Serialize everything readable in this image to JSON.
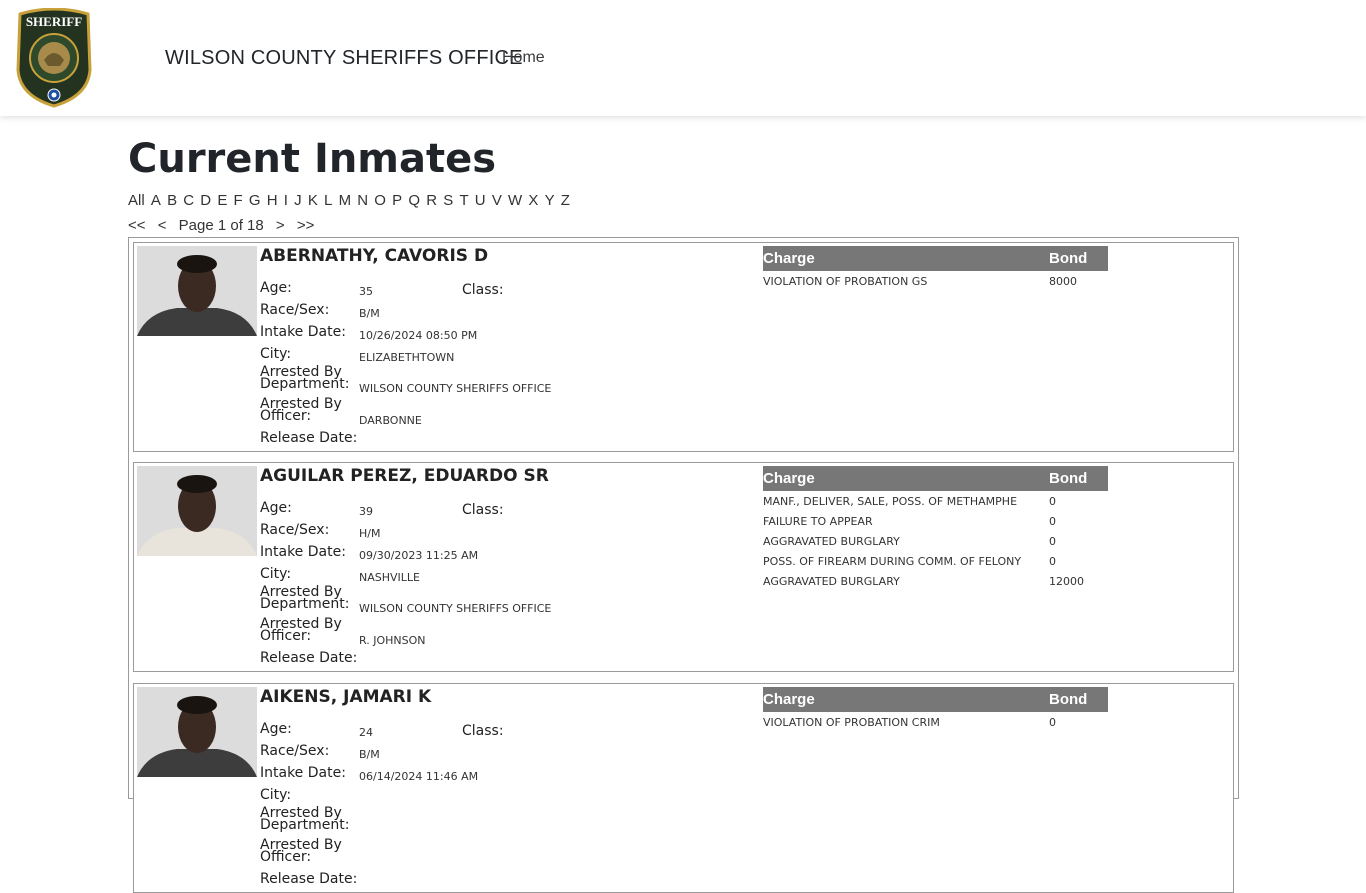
{
  "header": {
    "logo_text": "SHERIFF",
    "brand": "WILSON COUNTY SHERIFFS OFFICE",
    "nav_home": "Home"
  },
  "page_title": "Current Inmates",
  "alphabet": [
    "All",
    "A",
    "B",
    "C",
    "D",
    "E",
    "F",
    "G",
    "H",
    "I",
    "J",
    "K",
    "L",
    "M",
    "N",
    "O",
    "P",
    "Q",
    "R",
    "S",
    "T",
    "U",
    "V",
    "W",
    "X",
    "Y",
    "Z"
  ],
  "pager": {
    "first": "<<",
    "prev": "<",
    "text": "Page 1 of 18",
    "next": ">",
    "last": ">>"
  },
  "labels": {
    "age": "Age:",
    "class": "Class:",
    "race_sex": "Race/Sex:",
    "intake_date": "Intake Date:",
    "city": "City:",
    "arrested_by_department_1": "Arrested By",
    "arrested_by_department_2": "Department:",
    "arrested_by_officer_1": "Arrested By",
    "arrested_by_officer_2": "Officer:",
    "release_date": "Release Date:",
    "charge": "Charge",
    "bond": "Bond"
  },
  "inmates": [
    {
      "name": "ABERNATHY, CAVORIS D",
      "age": "35",
      "race_sex": "B/M",
      "intake_date": "10/26/2024 08:50 PM",
      "city": "ELIZABETHTOWN",
      "department": "WILSON COUNTY SHERIFFS OFFICE",
      "officer": "DARBONNE",
      "charges": [
        {
          "charge": "VIOLATION OF PROBATION GS",
          "bond": "8000"
        }
      ]
    },
    {
      "name": "AGUILAR PEREZ, EDUARDO SR",
      "age": "39",
      "race_sex": "H/M",
      "intake_date": "09/30/2023 11:25 AM",
      "city": "NASHVILLE",
      "department": "WILSON COUNTY SHERIFFS OFFICE",
      "officer": "R. JOHNSON",
      "charges": [
        {
          "charge": "MANF., DELIVER, SALE, POSS. OF METHAMPHE",
          "bond": "0"
        },
        {
          "charge": "FAILURE TO APPEAR",
          "bond": "0"
        },
        {
          "charge": "AGGRAVATED BURGLARY",
          "bond": "0"
        },
        {
          "charge": "POSS. OF FIREARM DURING COMM. OF FELONY",
          "bond": "0"
        },
        {
          "charge": "AGGRAVATED BURGLARY",
          "bond": "12000"
        }
      ]
    },
    {
      "name": "AIKENS, JAMARI K",
      "age": "24",
      "race_sex": "B/M",
      "intake_date": "06/14/2024 11:46 AM",
      "city": "",
      "department": "",
      "officer": "",
      "charges": [
        {
          "charge": "VIOLATION OF PROBATION CRIM",
          "bond": "0"
        }
      ]
    }
  ],
  "colors": {
    "charge_header_bg": "#777777",
    "border": "#9a9a9a",
    "badge_green": "#2f4a2a",
    "badge_gold": "#c9a13b"
  }
}
